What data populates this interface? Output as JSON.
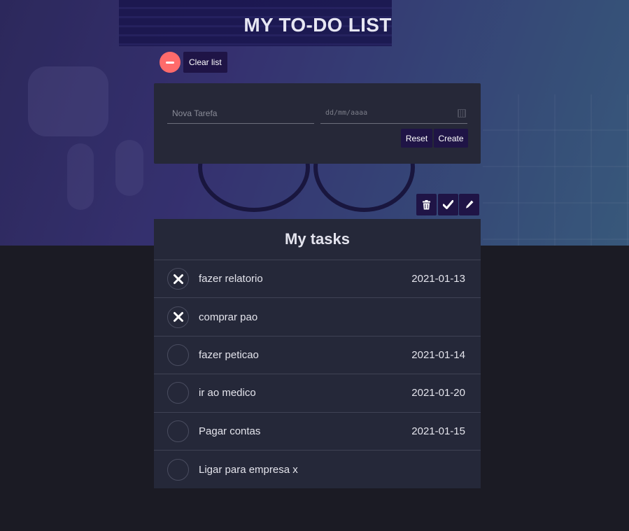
{
  "header": {
    "title": "MY TO-DO LIST"
  },
  "clear": {
    "label": "Clear list",
    "icon": "minus-icon",
    "color": "#ff6b6b"
  },
  "form": {
    "task_placeholder": "Nova Tarefa",
    "date_placeholder": "dd/mm/aaaa",
    "reset_label": "Reset",
    "create_label": "Create"
  },
  "toolbar": {
    "icons": [
      "trash-icon",
      "check-icon",
      "pencil-icon"
    ]
  },
  "tasks": {
    "title": "My tasks",
    "items": [
      {
        "name": "fazer relatorio",
        "date": "2021-01-13",
        "done": true
      },
      {
        "name": "comprar pao",
        "date": "",
        "done": true
      },
      {
        "name": "fazer peticao",
        "date": "2021-01-14",
        "done": false
      },
      {
        "name": "ir ao medico",
        "date": "2021-01-20",
        "done": false
      },
      {
        "name": "Pagar contas",
        "date": "2021-01-15",
        "done": false
      },
      {
        "name": "Ligar para empresa x",
        "date": "",
        "done": false
      }
    ]
  },
  "colors": {
    "button": "#1f1446",
    "card": "#262838",
    "page": "#1b1b24"
  }
}
